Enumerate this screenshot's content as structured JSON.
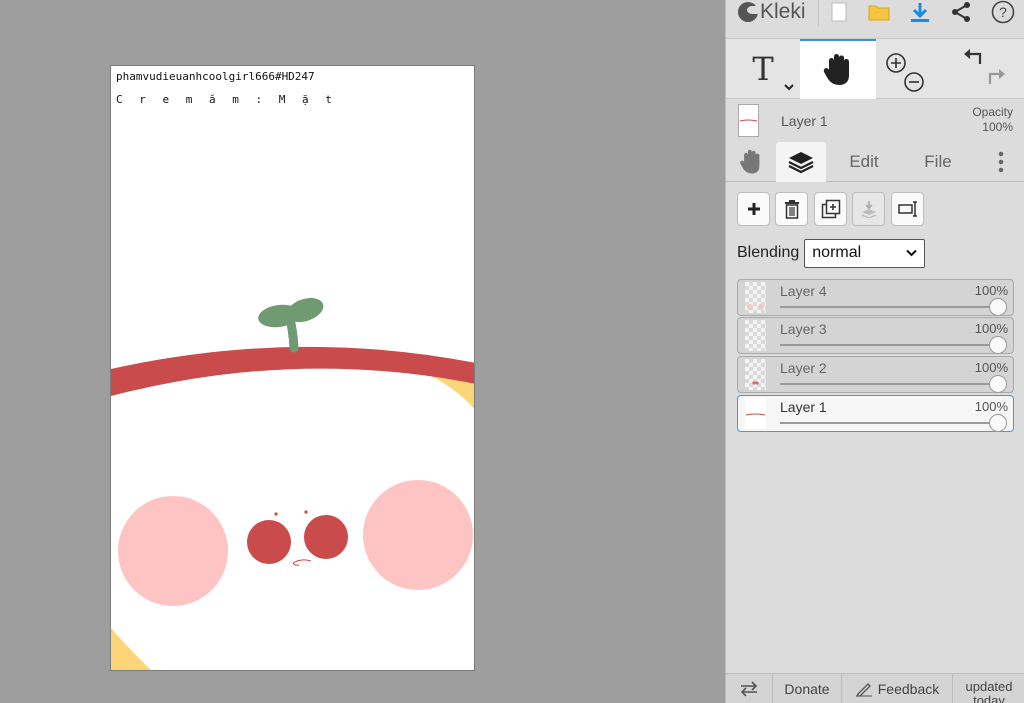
{
  "canvas": {
    "line1": "phamvudieuanhcoolgirl666#HD247",
    "line2": "C r e m ă m : M ặ t",
    "colors": {
      "apple_red": "#c94b4b",
      "stem_green": "#6f9a72",
      "cheek_pink": "#fec4c4",
      "yellow": "#fdd579",
      "background": "#ffffff"
    }
  },
  "workspace_bg": "#9e9e9e",
  "topbar": {
    "logo_text": "Kleki",
    "icons": [
      "logo-icon",
      "new-file-icon",
      "open-folder-icon",
      "download-icon",
      "share-icon",
      "help-icon"
    ]
  },
  "tools": {
    "text_tool_glyph": "T",
    "active_tool": "hand-tool",
    "icons": [
      "text-tool-icon",
      "hand-tool-icon",
      "zoom-in-icon",
      "zoom-out-icon",
      "undo-icon",
      "redo-icon"
    ]
  },
  "layer_preview": {
    "name": "Layer 1",
    "opacity_label": "Opacity",
    "opacity_value": "100%"
  },
  "tabs": {
    "edit": "Edit",
    "file": "File",
    "active": "layers"
  },
  "layer_actions": [
    "add-layer",
    "delete-layer",
    "duplicate-layer",
    "merge-down",
    "rename-layer"
  ],
  "blending": {
    "label": "Blending",
    "value": "normal"
  },
  "layers": [
    {
      "name": "Layer 4",
      "opacity": "100%",
      "active": false
    },
    {
      "name": "Layer 3",
      "opacity": "100%",
      "active": false
    },
    {
      "name": "Layer 2",
      "opacity": "100%",
      "active": false
    },
    {
      "name": "Layer 1",
      "opacity": "100%",
      "active": true
    }
  ],
  "bottombar": {
    "donate": "Donate",
    "feedback": "Feedback",
    "updated": "updated",
    "today": "today"
  },
  "accent": "#3b8de0"
}
